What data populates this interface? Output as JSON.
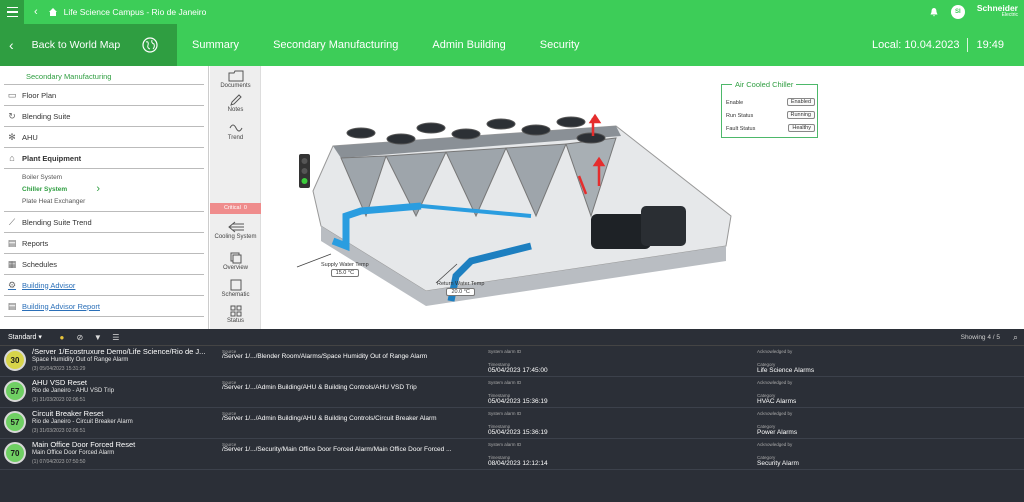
{
  "topbar": {
    "title": "Life Science Campus - Rio de Janeiro",
    "avatar": "SI",
    "logo": "Schneider",
    "logo_sub": "Electric"
  },
  "nav": {
    "back_label": "Back to World Map",
    "tabs": [
      "Summary",
      "Secondary Manufacturing",
      "Admin Building",
      "Security"
    ],
    "local_date": "Local: 10.04.2023",
    "local_time": "19:49"
  },
  "sidebar": {
    "header": "Secondary Manufacturing",
    "items": [
      {
        "label": "Floor Plan",
        "icon": "floor-plan-icon"
      },
      {
        "label": "Blending Suite",
        "icon": "refresh-icon"
      },
      {
        "label": "AHU",
        "icon": "fan-icon"
      },
      {
        "label": "Plant Equipment",
        "icon": "factory-icon"
      }
    ],
    "sub_items": [
      "Boiler System",
      "Chiller System",
      "Plate Heat Exchanger"
    ],
    "items2": [
      {
        "label": "Blending Suite Trend",
        "icon": "trend-icon"
      },
      {
        "label": "Reports",
        "icon": "report-icon"
      },
      {
        "label": "Schedules",
        "icon": "schedule-icon"
      },
      {
        "label": "Building Advisor",
        "icon": "gear-icon"
      },
      {
        "label": "Building Advisor Report",
        "icon": "report-icon"
      }
    ]
  },
  "tools": {
    "documents": "Documents",
    "notes": "Notes",
    "trend": "Trend",
    "critical": "Critical",
    "critical_count": "0",
    "cooling": "Cooling System",
    "overview": "Overview",
    "schematic": "Schematic",
    "status": "Status"
  },
  "chiller": {
    "title": "Air Cooled Chiller",
    "rows": [
      {
        "label": "Enable",
        "value": "Enabled"
      },
      {
        "label": "Run Status",
        "value": "Running"
      },
      {
        "label": "Fault Status",
        "value": "Healthy"
      }
    ],
    "supply_label": "Supply Water Temp",
    "supply_value": "15.0 °C",
    "return_label": "Return Water Temp",
    "return_value": "20.0 °C"
  },
  "alarms": {
    "filter": "Standard",
    "showing": "Showing 4 / 5",
    "label_source": "Source",
    "label_id": "System alarm ID",
    "label_timestamp": "Timestamp",
    "label_ack": "Acknowledged by",
    "label_category": "Category",
    "rows": [
      {
        "priority": "30",
        "title": "/Server 1/Ecostruxure Demo/Life Science/Rio de J...",
        "sub": "Space Humidity Out of Range Alarm",
        "meta": "(3) 05/04/2023 15:31:29",
        "source": "/Server 1/.../Blender Room/Alarms/Space Humidity Out of Range Alarm",
        "timestamp": "05/04/2023 17:45:00",
        "category": "Life Science Alarms"
      },
      {
        "priority": "57",
        "title": "AHU VSD Reset",
        "sub": "Rio de Janeiro - AHU VSD Trip",
        "meta": "(3) 31/03/2023 02:06:51",
        "source": "/Server 1/.../Admin Building/AHU & Building Controls/AHU VSD Trip",
        "timestamp": "05/04/2023 15:36:19",
        "category": "HVAC Alarms"
      },
      {
        "priority": "57",
        "title": "Circuit Breaker Reset",
        "sub": "Rio de Janeiro - Circuit Breaker Alarm",
        "meta": "(3) 31/03/2023 02:06:51",
        "source": "/Server 1/.../Admin Building/AHU & Building Controls/Circuit Breaker Alarm",
        "timestamp": "05/04/2023 15:36:19",
        "category": "Power Alarms"
      },
      {
        "priority": "70",
        "title": "Main Office Door Forced Reset",
        "sub": "Main Office Door Forced Alarm",
        "meta": "(1) 07/04/2023 07:50:50",
        "source": "/Server 1/.../Security/Main Office Door Forced Alarm/Main Office Door Forced ...",
        "timestamp": "08/04/2023 12:12:14",
        "category": "Security Alarm"
      }
    ]
  },
  "colors": {
    "brand": "#3dcd58",
    "brand_dark": "#2f9e41",
    "alarm_bg": "#2b2f37"
  }
}
